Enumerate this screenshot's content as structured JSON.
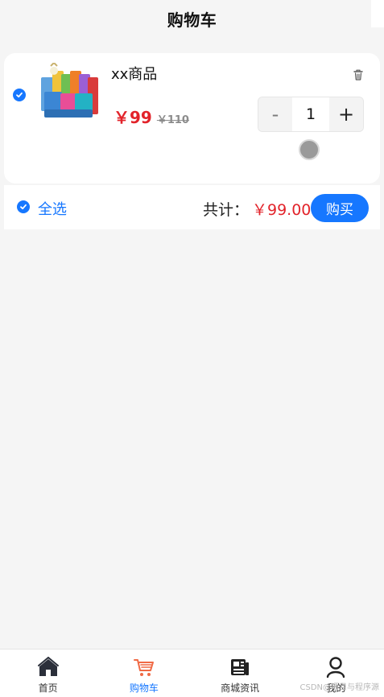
{
  "header": {
    "title": "购物车"
  },
  "cart": {
    "item": {
      "name": "xx商品",
      "price": "￥99",
      "old_price": "￥110",
      "quantity": "1",
      "minus_label": "-",
      "plus_label": "+",
      "image_icon": "product-image",
      "delete_icon": "trash-icon"
    }
  },
  "summary": {
    "select_all_label": "全选",
    "total_label": "共计：",
    "total_amount": "￥99.00",
    "buy_label": "购买"
  },
  "tabbar": {
    "items": [
      {
        "label": "首页",
        "icon": "home-icon"
      },
      {
        "label": "购物车",
        "icon": "cart-icon"
      },
      {
        "label": "商城资讯",
        "icon": "news-icon"
      },
      {
        "label": "我的",
        "icon": "user-icon"
      }
    ]
  },
  "watermark": "CSDN@项目与程序源",
  "colors": {
    "accent": "#1677ff",
    "price": "#e2232a",
    "background": "#f5f5f5",
    "card": "#ffffff",
    "cart_icon": "#f06a45"
  }
}
